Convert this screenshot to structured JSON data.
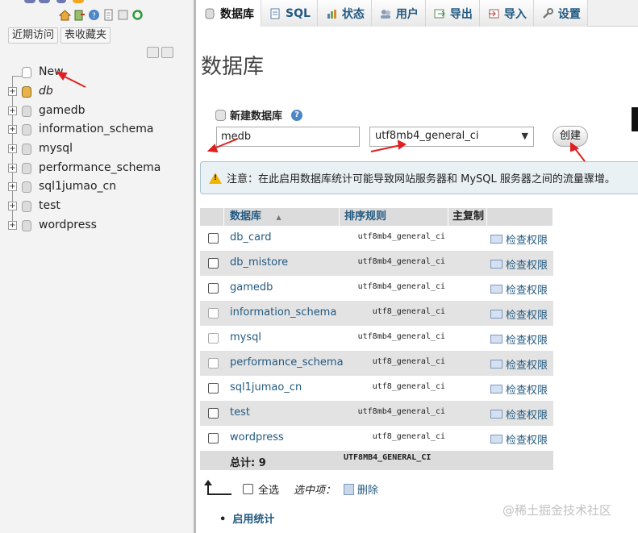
{
  "nav": {
    "recent_button": "近期访问",
    "favorites_button": "表收藏夹",
    "new_item": "New",
    "databases": [
      "db",
      "gamedb",
      "information_schema",
      "mysql",
      "performance_schema",
      "sql1jumao_cn",
      "test",
      "wordpress"
    ]
  },
  "tabs": [
    {
      "label": "数据库",
      "icon": "database-icon"
    },
    {
      "label": "SQL",
      "icon": "sql-icon"
    },
    {
      "label": "状态",
      "icon": "status-icon"
    },
    {
      "label": "用户",
      "icon": "users-icon"
    },
    {
      "label": "导出",
      "icon": "export-icon"
    },
    {
      "label": "导入",
      "icon": "import-icon"
    },
    {
      "label": "设置",
      "icon": "settings-icon"
    }
  ],
  "page": {
    "title": "数据库",
    "create_label": "新建数据库",
    "db_name_value": "medb",
    "collation_selected": "utf8mb4_general_ci",
    "create_button": "创建",
    "notice": "注意：在此启用数据库统计可能导致网站服务器和 MySQL 服务器之间的流量骤增。"
  },
  "table": {
    "headers": {
      "name": "数据库",
      "collation": "排序规则",
      "replication": "主复制"
    },
    "sort_indicator": "▲",
    "rows": [
      {
        "name": "db_card",
        "collation": "utf8mb4_general_ci",
        "priv": "检查权限"
      },
      {
        "name": "db_mistore",
        "collation": "utf8mb4_general_ci",
        "priv": "检查权限"
      },
      {
        "name": "gamedb",
        "collation": "utf8mb4_general_ci",
        "priv": "检查权限"
      },
      {
        "name": "information_schema",
        "collation": "utf8_general_ci",
        "priv": "检查权限"
      },
      {
        "name": "mysql",
        "collation": "utf8mb4_general_ci",
        "priv": "检查权限"
      },
      {
        "name": "performance_schema",
        "collation": "utf8_general_ci",
        "priv": "检查权限"
      },
      {
        "name": "sql1jumao_cn",
        "collation": "utf8_general_ci",
        "priv": "检查权限"
      },
      {
        "name": "test",
        "collation": "utf8mb4_general_ci",
        "priv": "检查权限"
      },
      {
        "name": "wordpress",
        "collation": "utf8_general_ci",
        "priv": "检查权限"
      }
    ],
    "total_label": "总计: 9",
    "total_collation": "UTF8MB4_GENERAL_CI"
  },
  "bulk": {
    "select_all": "全选",
    "with_selected": "选中项：",
    "delete": "删除"
  },
  "stats_link": "启用统计",
  "watermark": "@稀土掘金技术社区",
  "colors": {
    "link": "#235a81",
    "annotation": "#e02020",
    "notice_bg": "#e9f1f4"
  }
}
